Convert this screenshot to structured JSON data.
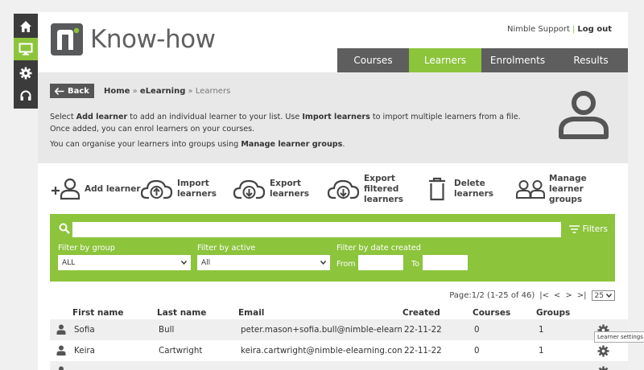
{
  "leftbar": {
    "items": [
      {
        "icon": "home-icon"
      },
      {
        "icon": "monitor-icon"
      },
      {
        "icon": "gear-icon"
      },
      {
        "icon": "headset-icon"
      }
    ]
  },
  "brand": {
    "name": "Know-how",
    "accent": "#8cc43c"
  },
  "toplinks": {
    "support": "Nimble Support",
    "separator": "|",
    "logout": "Log out"
  },
  "tabs": [
    {
      "label": "Courses"
    },
    {
      "label": "Learners"
    },
    {
      "label": "Enrolments"
    },
    {
      "label": "Results"
    }
  ],
  "breadcrumb": {
    "back": "Back",
    "home": "Home",
    "sep1": "»",
    "elearning": "eLearning",
    "sep2": "»",
    "current": "Learners"
  },
  "description": {
    "line1_a": "Select ",
    "line1_b": "Add learner",
    "line1_c": " to add an individual learner to your list. Use ",
    "line1_d": "Import learners",
    "line1_e": " to import multiple learners from a file.",
    "line2": "Once added, you can enrol learners on your courses.",
    "line3_a": "You can organise your learners into groups using ",
    "line3_b": "Manage learner groups",
    "line3_c": "."
  },
  "actions": {
    "add": "Add learner",
    "import_1": "Import",
    "import_2": "learners",
    "export_1": "Export",
    "export_2": "learners",
    "export_filtered_1": "Export",
    "export_filtered_2": "filtered",
    "export_filtered_3": "learners",
    "delete_1": "Delete",
    "delete_2": "learners",
    "manage_1": "Manage",
    "manage_2": "learner",
    "manage_3": "groups"
  },
  "filter": {
    "filters_label": "Filters",
    "group_label": "Filter by group",
    "group_value": "ALL",
    "active_label": "Filter by active",
    "active_value": "All",
    "date_label": "Filter by date created",
    "from_label": "From",
    "to_label": "To"
  },
  "pager": {
    "text": "Page:1/2 (1-25 of 46)",
    "first": "|<",
    "prev": "<",
    "next": ">",
    "last": ">|",
    "page_size": "25"
  },
  "table": {
    "headers": {
      "first": "First name",
      "last": "Last name",
      "email": "Email",
      "created": "Created",
      "courses": "Courses",
      "groups": "Groups"
    },
    "rows": [
      {
        "first": "Sofia",
        "last": "Bull",
        "email": "peter.mason+sofia.bull@nimble-elearning.com",
        "created": "22-11-22",
        "courses": "0",
        "groups": "1"
      },
      {
        "first": "Keira",
        "last": "Cartwright",
        "email": "keira.cartwright@nimble-elearning.com",
        "created": "22-11-22",
        "courses": "0",
        "groups": "1"
      },
      {
        "first": "",
        "last": "",
        "email": "",
        "created": "",
        "courses": "",
        "groups": ""
      }
    ]
  },
  "tooltip": "Learner settings"
}
